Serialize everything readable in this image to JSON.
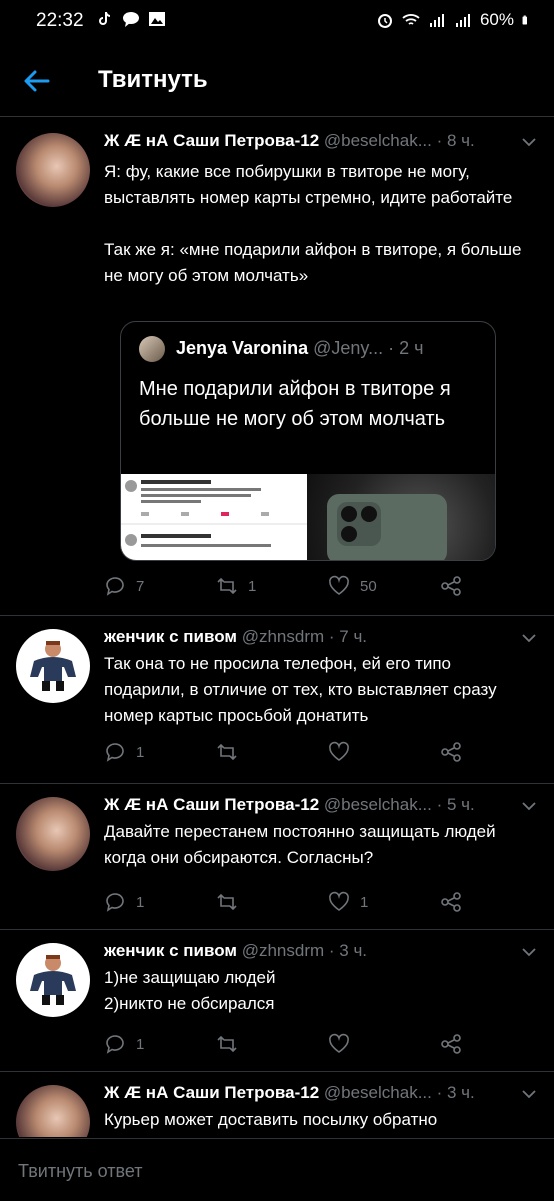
{
  "status_bar": {
    "time": "22:32",
    "battery": "60%",
    "left_icons": [
      "tiktok-icon",
      "chat-bubble-icon",
      "gallery-icon"
    ],
    "right_icons": [
      "alarm-icon",
      "wifi-icon",
      "signal-icon",
      "signal-icon",
      "battery-icon"
    ]
  },
  "header": {
    "title": "Твитнуть"
  },
  "tweets": [
    {
      "name": "Ж Æ нА Саши Петрова-12",
      "handle": "@beselchak...",
      "time": "· 8 ч.",
      "text": "Я: фу, какие все побирушки в твиторе не могу, выставлять номер карты стремно, идите работайте\n\nТак же я: «мне подарили айфон в твиторе, я больше не могу об этом молчать»",
      "quote": {
        "name": "Jenya Varonina",
        "handle": "@Jeny...",
        "time": "· 2 ч",
        "text": "Мне подарили айфон в твиторе я больше не могу об этом молчать"
      },
      "replies": "7",
      "retweets": "1",
      "likes": "50"
    },
    {
      "name": "женчик с пивом",
      "handle": "@zhnsdrm",
      "time": "· 7 ч.",
      "text": "Так она то не просила телефон, ей его типо подарили, в отличие от тех, кто выставляет сразу номер картыс просьбой донатить",
      "replies": "1",
      "retweets": "",
      "likes": ""
    },
    {
      "name": "Ж Æ нА Саши Петрова-12",
      "handle": "@beselchak...",
      "time": "· 5 ч.",
      "text": "Давайте перестанем постоянно защищать людей когда они обсираются. Согласны?",
      "replies": "1",
      "retweets": "",
      "likes": "1"
    },
    {
      "name": "женчик с пивом",
      "handle": "@zhnsdrm",
      "time": "· 3 ч.",
      "text": "1)не защищаю людей\n2)никто не обсирался",
      "replies": "1",
      "retweets": "",
      "likes": ""
    },
    {
      "name": "Ж Æ нА Саши Петрова-12",
      "handle": "@beselchak...",
      "time": "· 3 ч.",
      "text": "Курьер может доставить посылку обратно отправителю, он указан при покупке или заказе"
    }
  ],
  "composer": {
    "placeholder": "Твитнуть ответ"
  },
  "colors": {
    "accent": "#1d9bf0",
    "muted": "#71767b",
    "divider": "#2f3336"
  }
}
